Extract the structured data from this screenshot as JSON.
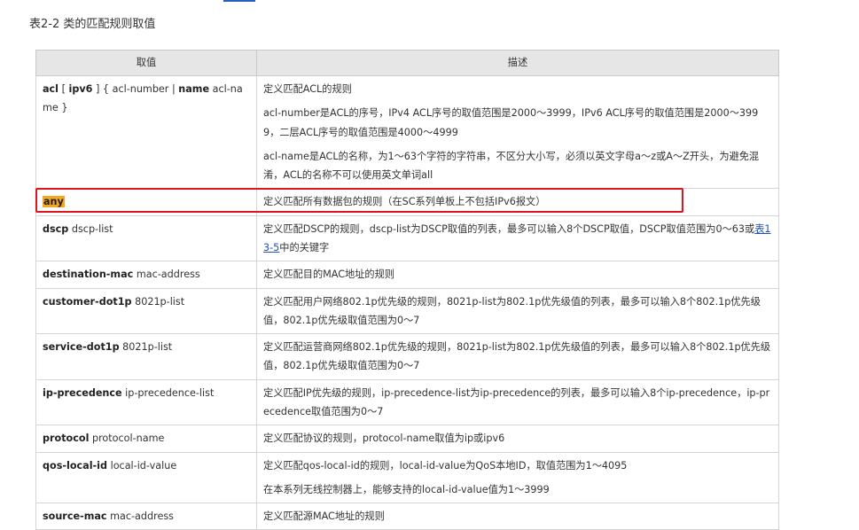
{
  "caption": "表2-2 类的匹配规则取值",
  "header": {
    "col1": "取值",
    "col2": "描述"
  },
  "rows": [
    {
      "val": [
        {
          "t": "acl",
          "s": "kw"
        },
        {
          "t": " [ ",
          "s": "param"
        },
        {
          "t": "ipv6",
          "s": "kw"
        },
        {
          "t": " ] { acl-number | ",
          "s": "param"
        },
        {
          "t": "name",
          "s": "kw"
        },
        {
          "t": " acl-name }",
          "s": "param"
        }
      ],
      "desc": [
        "定义匹配ACL的规则",
        "acl-number是ACL的序号，IPv4 ACL序号的取值范围是2000～3999，IPv6 ACL序号的取值范围是2000～3999，二层ACL序号的取值范围是4000～4999",
        "acl-name是ACL的名称，为1～63个字符的字符串，不区分大小写，必须以英文字母a～z或A～Z开头，为避免混淆，ACL的名称不可以使用英文单词all"
      ]
    },
    {
      "val": [
        {
          "t": "any",
          "s": "hl"
        }
      ],
      "desc": [
        "定义匹配所有数据包的规则（在SC系列单板上不包括IPv6报文）"
      ],
      "highlighted": true
    },
    {
      "val": [
        {
          "t": "dscp",
          "s": "kw"
        },
        {
          "t": " dscp-list",
          "s": "param"
        }
      ],
      "desc_rich": [
        {
          "t": "定义匹配DSCP的规则，dscp-list为DSCP取值的列表，最多可以输入8个DSCP取值，DSCP取值范围为0～63或",
          "s": "text"
        },
        {
          "t": "表13-5",
          "s": "link"
        },
        {
          "t": "中的关键字",
          "s": "text"
        }
      ]
    },
    {
      "val": [
        {
          "t": "destination-mac",
          "s": "kw"
        },
        {
          "t": " mac-address",
          "s": "param"
        }
      ],
      "desc": [
        "定义匹配目的MAC地址的规则"
      ]
    },
    {
      "val": [
        {
          "t": "customer-dot1p",
          "s": "kw"
        },
        {
          "t": " 8021p-list",
          "s": "param"
        }
      ],
      "desc": [
        "定义匹配用户网络802.1p优先级的规则，8021p-list为802.1p优先级值的列表，最多可以输入8个802.1p优先级值，802.1p优先级取值范围为0～7"
      ]
    },
    {
      "val": [
        {
          "t": "service-dot1p",
          "s": "kw"
        },
        {
          "t": " 8021p-list",
          "s": "param"
        }
      ],
      "desc": [
        "定义匹配运营商网络802.1p优先级的规则，8021p-list为802.1p优先级值的列表，最多可以输入8个802.1p优先级值，802.1p优先级取值范围为0～7"
      ]
    },
    {
      "val": [
        {
          "t": "ip-precedence",
          "s": "kw"
        },
        {
          "t": " ip-precedence-list",
          "s": "param"
        }
      ],
      "desc": [
        "定义匹配IP优先级的规则，ip-precedence-list为ip-precedence的列表，最多可以输入8个ip-precedence，ip-precedence取值范围为0～7"
      ]
    },
    {
      "val": [
        {
          "t": "protocol",
          "s": "kw"
        },
        {
          "t": " protocol-name",
          "s": "param"
        }
      ],
      "desc": [
        "定义匹配协议的规则，protocol-name取值为ip或ipv6"
      ]
    },
    {
      "val": [
        {
          "t": "qos-local-id",
          "s": "kw"
        },
        {
          "t": " local-id-value",
          "s": "param"
        }
      ],
      "desc": [
        "定义匹配qos-local-id的规则，local-id-value为QoS本地ID，取值范围为1～4095",
        "在本系列无线控制器上，能够支持的local-id-value值为1～3999"
      ]
    },
    {
      "val": [
        {
          "t": "source-mac",
          "s": "kw"
        },
        {
          "t": " mac-address",
          "s": "param"
        }
      ],
      "desc": [
        "定义匹配源MAC地址的规则"
      ]
    }
  ]
}
